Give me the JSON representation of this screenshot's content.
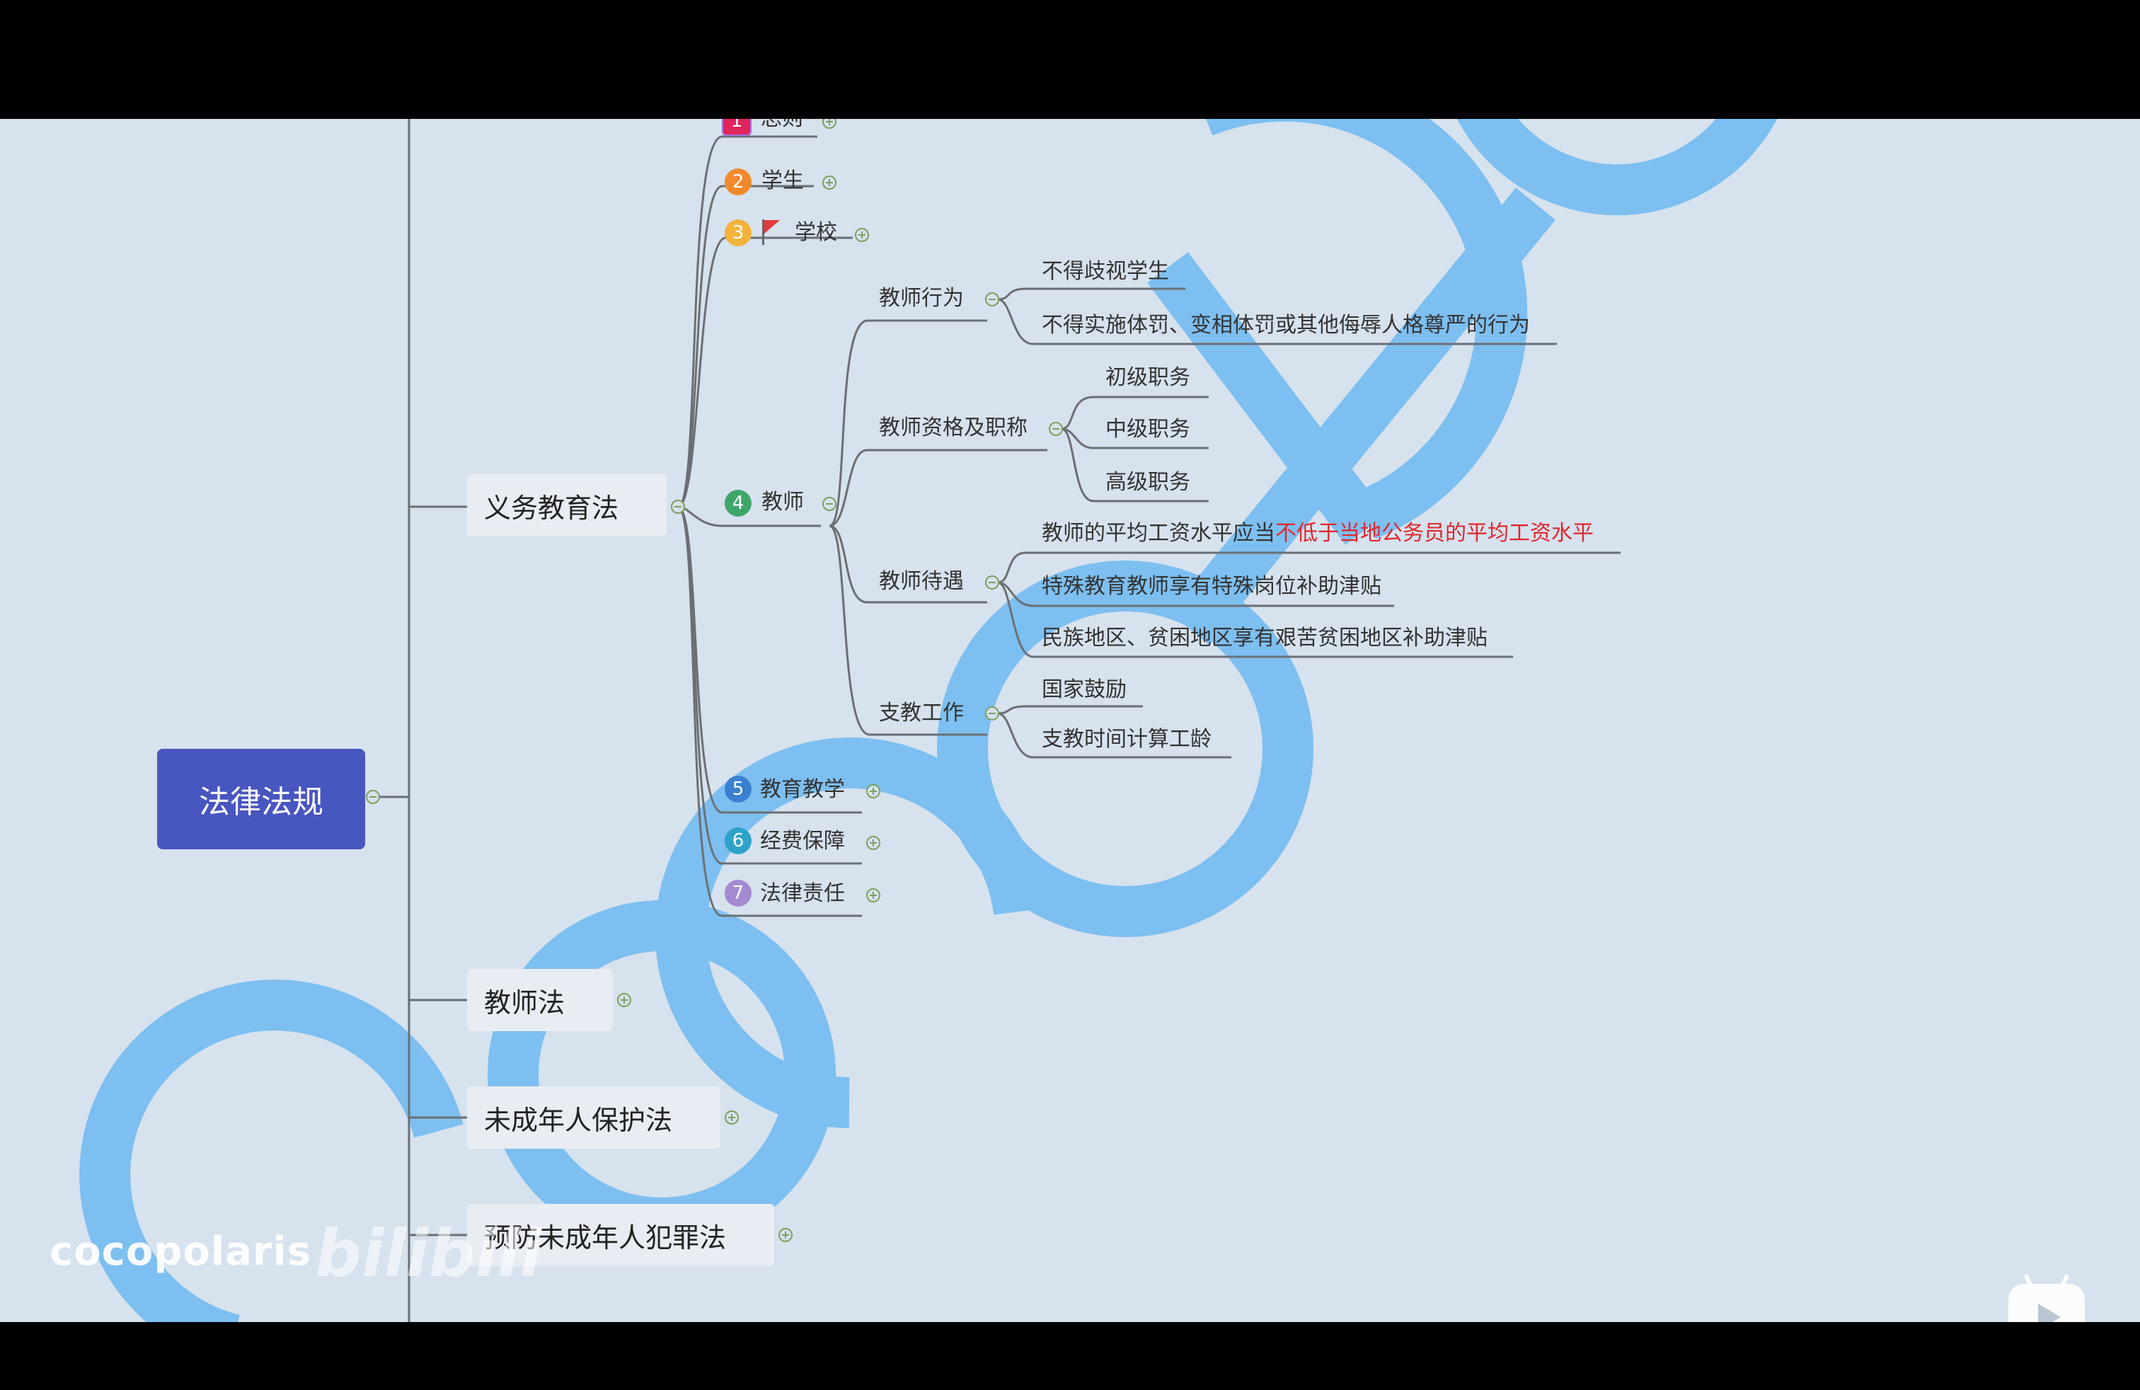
{
  "colors": {
    "root_bg": "#4856c0",
    "connector": "#6b6f75",
    "watermark": "#7dbff0",
    "highlight": "#e0262a",
    "toggle": "#7da05a"
  },
  "mindmap": {
    "root": "法律法规",
    "law_yiwu": "义务教育法",
    "law_jiaoshi": "教师法",
    "law_weicheng": "未成年人保护法",
    "law_yufang": "预防未成年人犯罪法",
    "chapters": {
      "c1": {
        "num": "1",
        "label": "总则",
        "color": "#e0245e"
      },
      "c2": {
        "num": "2",
        "label": "学生",
        "color": "#f08a2c"
      },
      "c3": {
        "num": "3",
        "label": "学校",
        "color": "#f3b33c"
      },
      "c4": {
        "num": "4",
        "label": "教师",
        "color": "#3fa66a"
      },
      "c5": {
        "num": "5",
        "label": "教育教学",
        "color": "#3b7fd1"
      },
      "c6": {
        "num": "6",
        "label": "经费保障",
        "color": "#2ea3c9"
      },
      "c7": {
        "num": "7",
        "label": "法律责任",
        "color": "#a48ad0"
      }
    },
    "teacher": {
      "behavior": "教师行为",
      "behavior_items": [
        "不得歧视学生",
        "不得实施体罚、变相体罚或其他侮辱人格尊严的行为"
      ],
      "qualification": "教师资格及职称",
      "qualification_items": [
        "初级职务",
        "中级职务",
        "高级职务"
      ],
      "treatment": "教师待遇",
      "treatment_1_prefix": "教师的平均工资水平应当",
      "treatment_1_highlight": "不低于当地公务员的平均工资水平",
      "treatment_items": [
        "特殊教育教师享有特殊岗位补助津贴",
        "民族地区、贫困地区享有艰苦贫困地区补助津贴"
      ],
      "support": "支教工作",
      "support_items": [
        "国家鼓励",
        "支教时间计算工龄"
      ]
    }
  },
  "overlay": {
    "brand_text": "cocopolaris",
    "brand_logo": "bilibili",
    "toolbar": [
      "pen-icon",
      "bulb-icon",
      "zoom-icon",
      "more-icon",
      "panel-icon",
      "collapse-icon"
    ]
  }
}
